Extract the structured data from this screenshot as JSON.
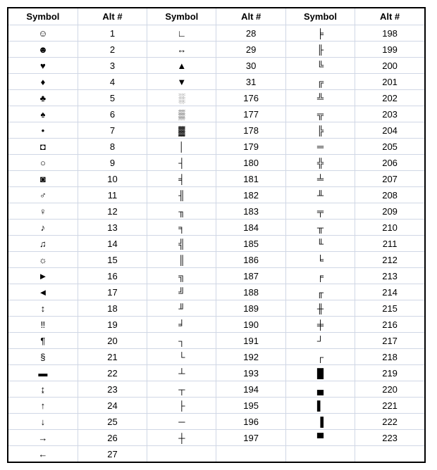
{
  "headers": [
    "Symbol",
    "Alt #",
    "Symbol",
    "Alt #",
    "Symbol",
    "Alt #"
  ],
  "rows": [
    {
      "c1s": "☺",
      "c1a": "1",
      "c2s": "∟",
      "c2a": "28",
      "c3s": "╞",
      "c3a": "198"
    },
    {
      "c1s": "☻",
      "c1a": "2",
      "c2s": "↔",
      "c2a": "29",
      "c3s": "╟",
      "c3a": "199"
    },
    {
      "c1s": "♥",
      "c1a": "3",
      "c2s": "▲",
      "c2a": "30",
      "c3s": "╚",
      "c3a": "200"
    },
    {
      "c1s": "♦",
      "c1a": "4",
      "c2s": "▼",
      "c2a": "31",
      "c3s": "╔",
      "c3a": "201"
    },
    {
      "c1s": "♣",
      "c1a": "5",
      "c2s": "░",
      "c2a": "176",
      "c3s": "╩",
      "c3a": "202"
    },
    {
      "c1s": "♠",
      "c1a": "6",
      "c2s": "▒",
      "c2a": "177",
      "c3s": "╦",
      "c3a": "203"
    },
    {
      "c1s": "•",
      "c1a": "7",
      "c2s": "▓",
      "c2a": "178",
      "c3s": "╠",
      "c3a": "204"
    },
    {
      "c1s": "◘",
      "c1a": "8",
      "c2s": "│",
      "c2a": "179",
      "c3s": "═",
      "c3a": "205"
    },
    {
      "c1s": "○",
      "c1a": "9",
      "c2s": "┤",
      "c2a": "180",
      "c3s": "╬",
      "c3a": "206"
    },
    {
      "c1s": "◙",
      "c1a": "10",
      "c2s": "╡",
      "c2a": "181",
      "c3s": "╧",
      "c3a": "207"
    },
    {
      "c1s": "♂",
      "c1a": "11",
      "c2s": "╢",
      "c2a": "182",
      "c3s": "╨",
      "c3a": "208"
    },
    {
      "c1s": "♀",
      "c1a": "12",
      "c2s": "╖",
      "c2a": "183",
      "c3s": "╤",
      "c3a": "209"
    },
    {
      "c1s": "♪",
      "c1a": "13",
      "c2s": "╕",
      "c2a": "184",
      "c3s": "╥",
      "c3a": "210"
    },
    {
      "c1s": "♫",
      "c1a": "14",
      "c2s": "╣",
      "c2a": "185",
      "c3s": "╙",
      "c3a": "211"
    },
    {
      "c1s": "☼",
      "c1a": "15",
      "c2s": "║",
      "c2a": "186",
      "c3s": "╘",
      "c3a": "212"
    },
    {
      "c1s": "►",
      "c1a": "16",
      "c2s": "╗",
      "c2a": "187",
      "c3s": "╒",
      "c3a": "213"
    },
    {
      "c1s": "◄",
      "c1a": "17",
      "c2s": "╝",
      "c2a": "188",
      "c3s": "╓",
      "c3a": "214"
    },
    {
      "c1s": "↕",
      "c1a": "18",
      "c2s": "╜",
      "c2a": "189",
      "c3s": "╫",
      "c3a": "215"
    },
    {
      "c1s": "‼",
      "c1a": "19",
      "c2s": "╛",
      "c2a": "190",
      "c3s": "╪",
      "c3a": "216"
    },
    {
      "c1s": "¶",
      "c1a": "20",
      "c2s": "┐",
      "c2a": "191",
      "c3s": "┘",
      "c3a": "217"
    },
    {
      "c1s": "§",
      "c1a": "21",
      "c2s": "└",
      "c2a": "192",
      "c3s": "┌",
      "c3a": "218"
    },
    {
      "c1s": "▬",
      "c1a": "22",
      "c2s": "┴",
      "c2a": "193",
      "c3s": "█",
      "c3a": "219"
    },
    {
      "c1s": "↨",
      "c1a": "23",
      "c2s": "┬",
      "c2a": "194",
      "c3s": "▄",
      "c3a": "220"
    },
    {
      "c1s": "↑",
      "c1a": "24",
      "c2s": "├",
      "c2a": "195",
      "c3s": "▌",
      "c3a": "221"
    },
    {
      "c1s": "↓",
      "c1a": "25",
      "c2s": "─",
      "c2a": "196",
      "c3s": "▐",
      "c3a": "222"
    },
    {
      "c1s": "→",
      "c1a": "26",
      "c2s": "┼",
      "c2a": "197",
      "c3s": "▀",
      "c3a": "223"
    },
    {
      "c1s": "←",
      "c1a": "27",
      "c2s": "",
      "c2a": "",
      "c3s": "",
      "c3a": ""
    }
  ]
}
